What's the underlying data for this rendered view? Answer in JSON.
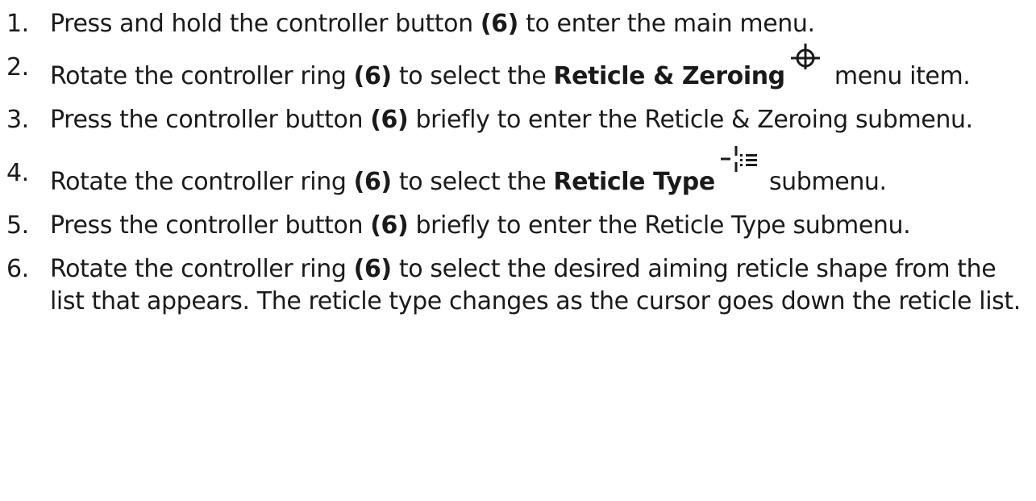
{
  "steps": [
    {
      "number": "1.",
      "parts": [
        "Press and hold the controller button ",
        "(6)",
        " to enter the main menu."
      ]
    },
    {
      "number": "2.",
      "parts": [
        "Rotate the controller ring ",
        "(6)",
        " to select the ",
        "Reticle & Zeroing",
        " menu item."
      ],
      "icon": "crosshair-icon"
    },
    {
      "number": "3.",
      "parts": [
        "Press the controller button ",
        "(6)",
        " briefly to enter the Reticle & Zeroing submenu."
      ]
    },
    {
      "number": "4.",
      "parts": [
        "Rotate the controller ring ",
        "(6)",
        " to select the ",
        "Reticle Type",
        " submenu."
      ],
      "icon": "reticle-type-icon"
    },
    {
      "number": "5.",
      "parts": [
        "Press the controller button ",
        "(6)",
        " briefly to enter the Reticle Type submenu."
      ]
    },
    {
      "number": "6.",
      "parts": [
        "Rotate the controller ring ",
        "(6)",
        " to select the desired aiming reticle shape from the list that appears. The reticle type changes as the cursor goes down the reticle list."
      ]
    }
  ]
}
